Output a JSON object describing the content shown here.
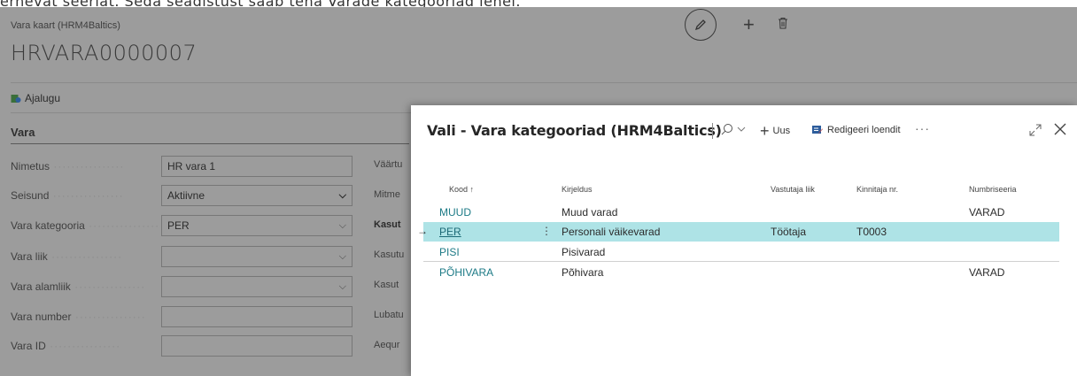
{
  "top_caption": "ernevat seeriat. Seda seadistust saab teha Varade kategooriad lehel.",
  "card": {
    "breadcrumb": "Vara kaart (HRM4Baltics)",
    "title": "HRVARA0000007",
    "history_label": "Ajalugu",
    "section_title": "Vara"
  },
  "fields": [
    {
      "label": "Nimetus",
      "value": "HR vara 1",
      "kind": "text"
    },
    {
      "label": "Seisund",
      "value": "Aktiivne",
      "kind": "select-dark"
    },
    {
      "label": "Vara kategooria",
      "value": "PER",
      "kind": "select"
    },
    {
      "label": "Vara liik",
      "value": "",
      "kind": "select"
    },
    {
      "label": "Vara alamliik",
      "value": "",
      "kind": "select"
    },
    {
      "label": "Vara number",
      "value": "",
      "kind": "text"
    },
    {
      "label": "Vara ID",
      "value": "",
      "kind": "text"
    }
  ],
  "right_labels": [
    "Väärtu",
    "Mitme",
    "Kasut",
    "Kasutu",
    "Kasut",
    "Lubatu",
    "Aequr"
  ],
  "dialog": {
    "title": "Vali - Vara kategooriad (HRM4Baltics)",
    "new_label": "Uus",
    "edit_list_label": "Redigeeri loendit",
    "more_label": "···",
    "columns": [
      "Kood ↑",
      "Kirjeldus",
      "Vastutaja liik",
      "Kinnitaja nr.",
      "Numbriseeria"
    ],
    "rows": [
      {
        "code": "MUUD",
        "desc": "Muud varad",
        "resp": "",
        "approver": "",
        "series": "VARAD",
        "selected": false
      },
      {
        "code": "PER",
        "desc": "Personali väikevarad",
        "resp": "Töötaja",
        "approver": "T0003",
        "series": "",
        "selected": true
      },
      {
        "code": "PISI",
        "desc": "Pisivarad",
        "resp": "",
        "approver": "",
        "series": "",
        "selected": false
      },
      {
        "code": "PÕHIVARA",
        "desc": "Põhivara",
        "resp": "",
        "approver": "",
        "series": "VARAD",
        "selected": false
      }
    ]
  },
  "colors": {
    "accent": "#1c7a86",
    "selected_row": "#aee3e6",
    "overlay_bg": "#9c9c9c"
  }
}
